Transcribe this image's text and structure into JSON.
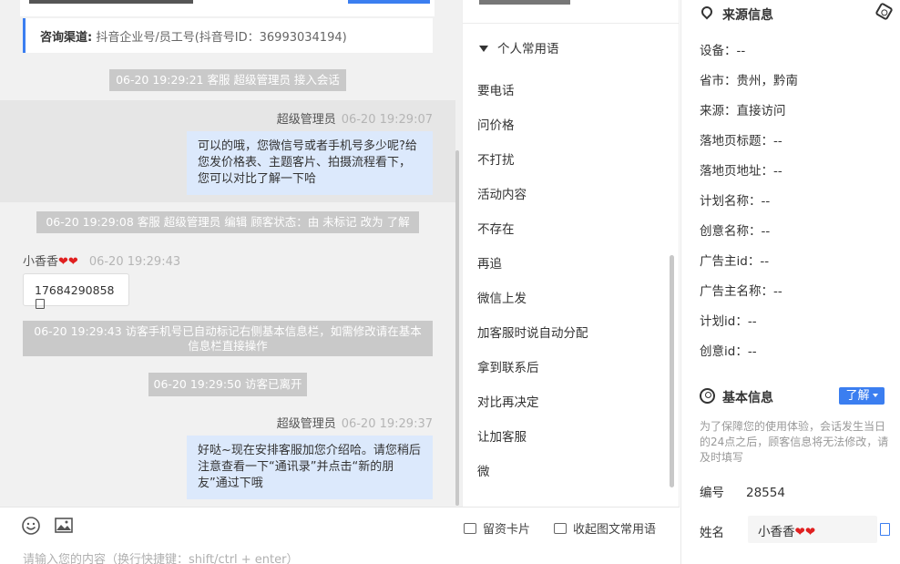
{
  "chat": {
    "channel_label": "咨询渠道:",
    "channel_value": "抖音企业号/员工号(抖音号ID：36993034194)",
    "system_1": "06-20 19:29:21 客服 超级管理员 接入会话",
    "op_msg_1": {
      "sender": "超级管理员",
      "time": "06-20 19:29:07",
      "text": "可以的哦，您微信号或者手机号多少呢?给您发价格表、主题客片、拍摄流程看下，您可以对比了解一下哈"
    },
    "system_2": "06-20 19:29:08 客服 超级管理员 编辑 顾客状态：由 未标记 改为 了解",
    "visitor_msg": {
      "sender": "小香香",
      "time": "06-20 19:29:43",
      "phone": "17684290858"
    },
    "system_3": "06-20 19:29:43 访客手机号已自动标记右侧基本信息栏，如需修改请在基本信息栏直接操作",
    "system_4": "06-20 19:29:50 访客已离开",
    "op_msg_2": {
      "sender": "超级管理员",
      "time": "06-20 19:29:37",
      "text": "好哒~现在安排客服加您介绍哈。请您稍后注意查看一下“通讯录”并点击“新的朋友”通过下哦"
    }
  },
  "input": {
    "placeholder": "请输入您的内容（换行快捷键：shift/ctrl + enter）",
    "card_btn": "留资卡片",
    "collapse_btn": "收起图文常用语"
  },
  "phrases": {
    "group_label": "个人常用语",
    "items": [
      "要电话",
      "问价格",
      "不打扰",
      "活动内容",
      "不存在",
      "再追",
      "微信上发",
      "加客服时说自动分配",
      "拿到联系后",
      "对比再决定",
      "让加客服",
      "微"
    ]
  },
  "info": {
    "source_title": "来源信息",
    "fields": [
      {
        "label": "设备：",
        "value": "--"
      },
      {
        "label": "省市：",
        "value": "贵州，黔南"
      },
      {
        "label": "来源：",
        "value": "直接访问"
      },
      {
        "label": "落地页标题：",
        "value": "--"
      },
      {
        "label": "落地页地址：",
        "value": "--"
      },
      {
        "label": "计划名称：",
        "value": "--"
      },
      {
        "label": "创意名称：",
        "value": "--"
      },
      {
        "label": "广告主id：",
        "value": "--"
      },
      {
        "label": "广告主名称：",
        "value": "--"
      },
      {
        "label": "计划id：",
        "value": "--"
      },
      {
        "label": "创意id：",
        "value": "--"
      }
    ],
    "basic_title": "基本信息",
    "learn_btn": "了解",
    "notice": "为了保障您的使用体验，会话发生当日的24点之后，顾客信息将无法修改，请及时填写",
    "id_label": "编号",
    "id_value": "28554",
    "name_label": "姓名",
    "name_value": "小香香"
  },
  "colors": {
    "accent": "#3b7ef0",
    "bubble": "#dce9fc",
    "system": "#c9c9c9"
  }
}
